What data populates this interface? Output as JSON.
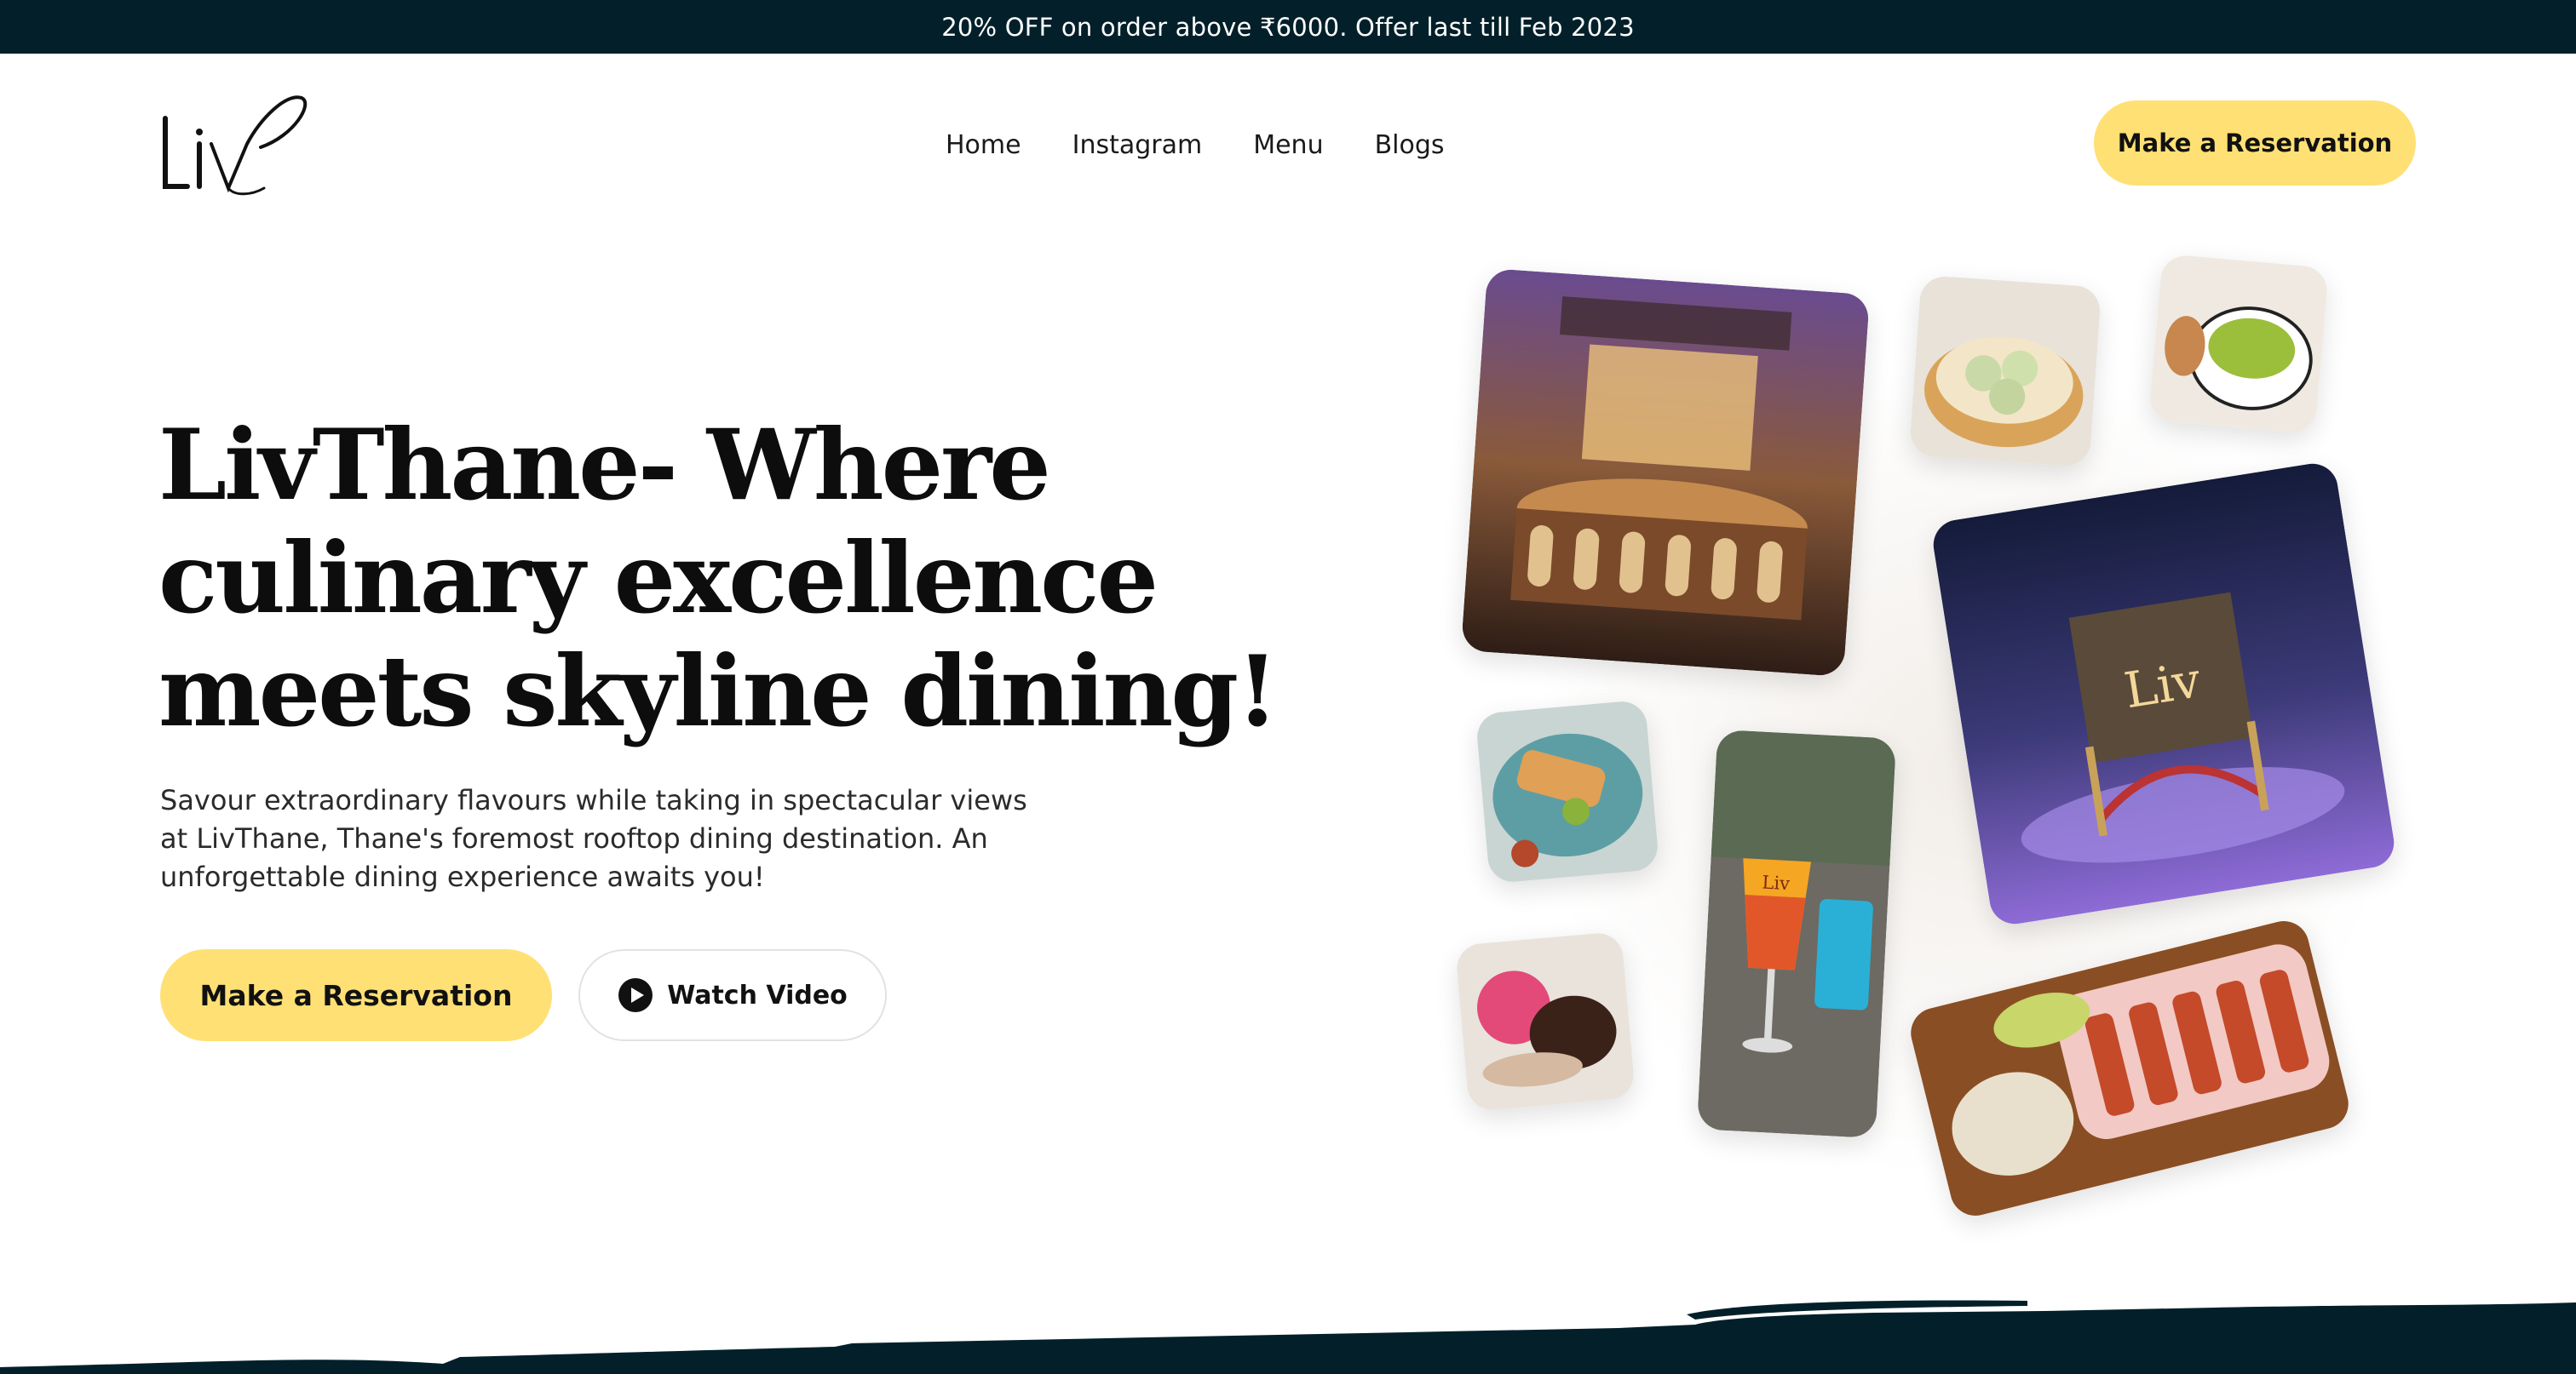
{
  "promo": {
    "text": "20% OFF on order above ₹6000. Offer last till Feb 2023"
  },
  "brand": {
    "logo_text": "Liv"
  },
  "nav": {
    "items": [
      {
        "label": "Home"
      },
      {
        "label": "Instagram"
      },
      {
        "label": "Menu"
      },
      {
        "label": "Blogs"
      }
    ]
  },
  "header": {
    "cta_label": "Make a Reservation"
  },
  "hero": {
    "title_lines": [
      "LivThane- Where",
      "culinary excellence",
      "meets skyline dining!"
    ],
    "subtitle_lines": [
      "Savour extraordinary flavours while taking in spectacular views",
      "at LivThane, Thane's foremost rooftop dining destination. An",
      "unforgettable dining experience awaits you!"
    ],
    "reserve_label": "Make a Reservation",
    "video_label": "Watch Video"
  },
  "gallery": {
    "photos": [
      {
        "subject": "bar-interior"
      },
      {
        "subject": "dim-sum"
      },
      {
        "subject": "soup-bowl"
      },
      {
        "subject": "rooftop-entrance"
      },
      {
        "subject": "plated-dish"
      },
      {
        "subject": "cocktails"
      },
      {
        "subject": "dessert"
      },
      {
        "subject": "kebab-platter"
      }
    ]
  },
  "colors": {
    "promo_bg": "#03202a",
    "accent_yellow": "#ffe074",
    "text_dark": "#0d0d0d",
    "band_dark": "#03202a"
  },
  "icons": {
    "play": "play-circle-icon"
  }
}
